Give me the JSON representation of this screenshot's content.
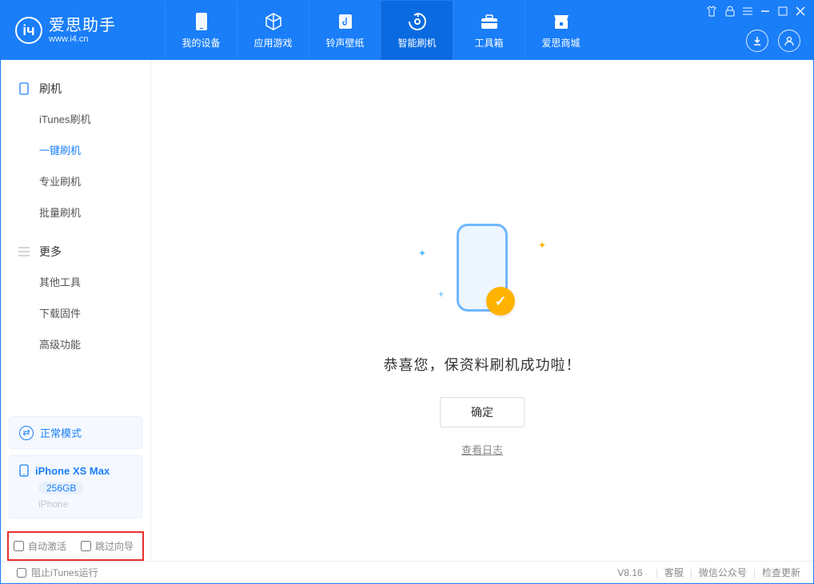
{
  "app": {
    "title": "爱思助手",
    "subtitle": "www.i4.cn"
  },
  "nav": {
    "items": [
      {
        "label": "我的设备",
        "icon": "device"
      },
      {
        "label": "应用游戏",
        "icon": "cube"
      },
      {
        "label": "铃声壁纸",
        "icon": "music"
      },
      {
        "label": "智能刷机",
        "icon": "refresh"
      },
      {
        "label": "工具箱",
        "icon": "toolbox"
      },
      {
        "label": "爱思商城",
        "icon": "shop"
      }
    ]
  },
  "sidebar": {
    "section1": {
      "title": "刷机",
      "items": [
        "iTunes刷机",
        "一键刷机",
        "专业刷机",
        "批量刷机"
      ]
    },
    "section2": {
      "title": "更多",
      "items": [
        "其他工具",
        "下载固件",
        "高级功能"
      ]
    },
    "mode": "正常模式",
    "device": {
      "name": "iPhone XS Max",
      "storage": "256GB",
      "type": "iPhone"
    },
    "checkboxes": {
      "auto_activate": "自动激活",
      "skip_guide": "跳过向导"
    }
  },
  "main": {
    "success_message": "恭喜您，保资料刷机成功啦！",
    "ok_button": "确定",
    "view_log": "查看日志"
  },
  "footer": {
    "stop_itunes": "阻止iTunes运行",
    "version": "V8.16",
    "links": [
      "客服",
      "微信公众号",
      "检查更新"
    ]
  }
}
